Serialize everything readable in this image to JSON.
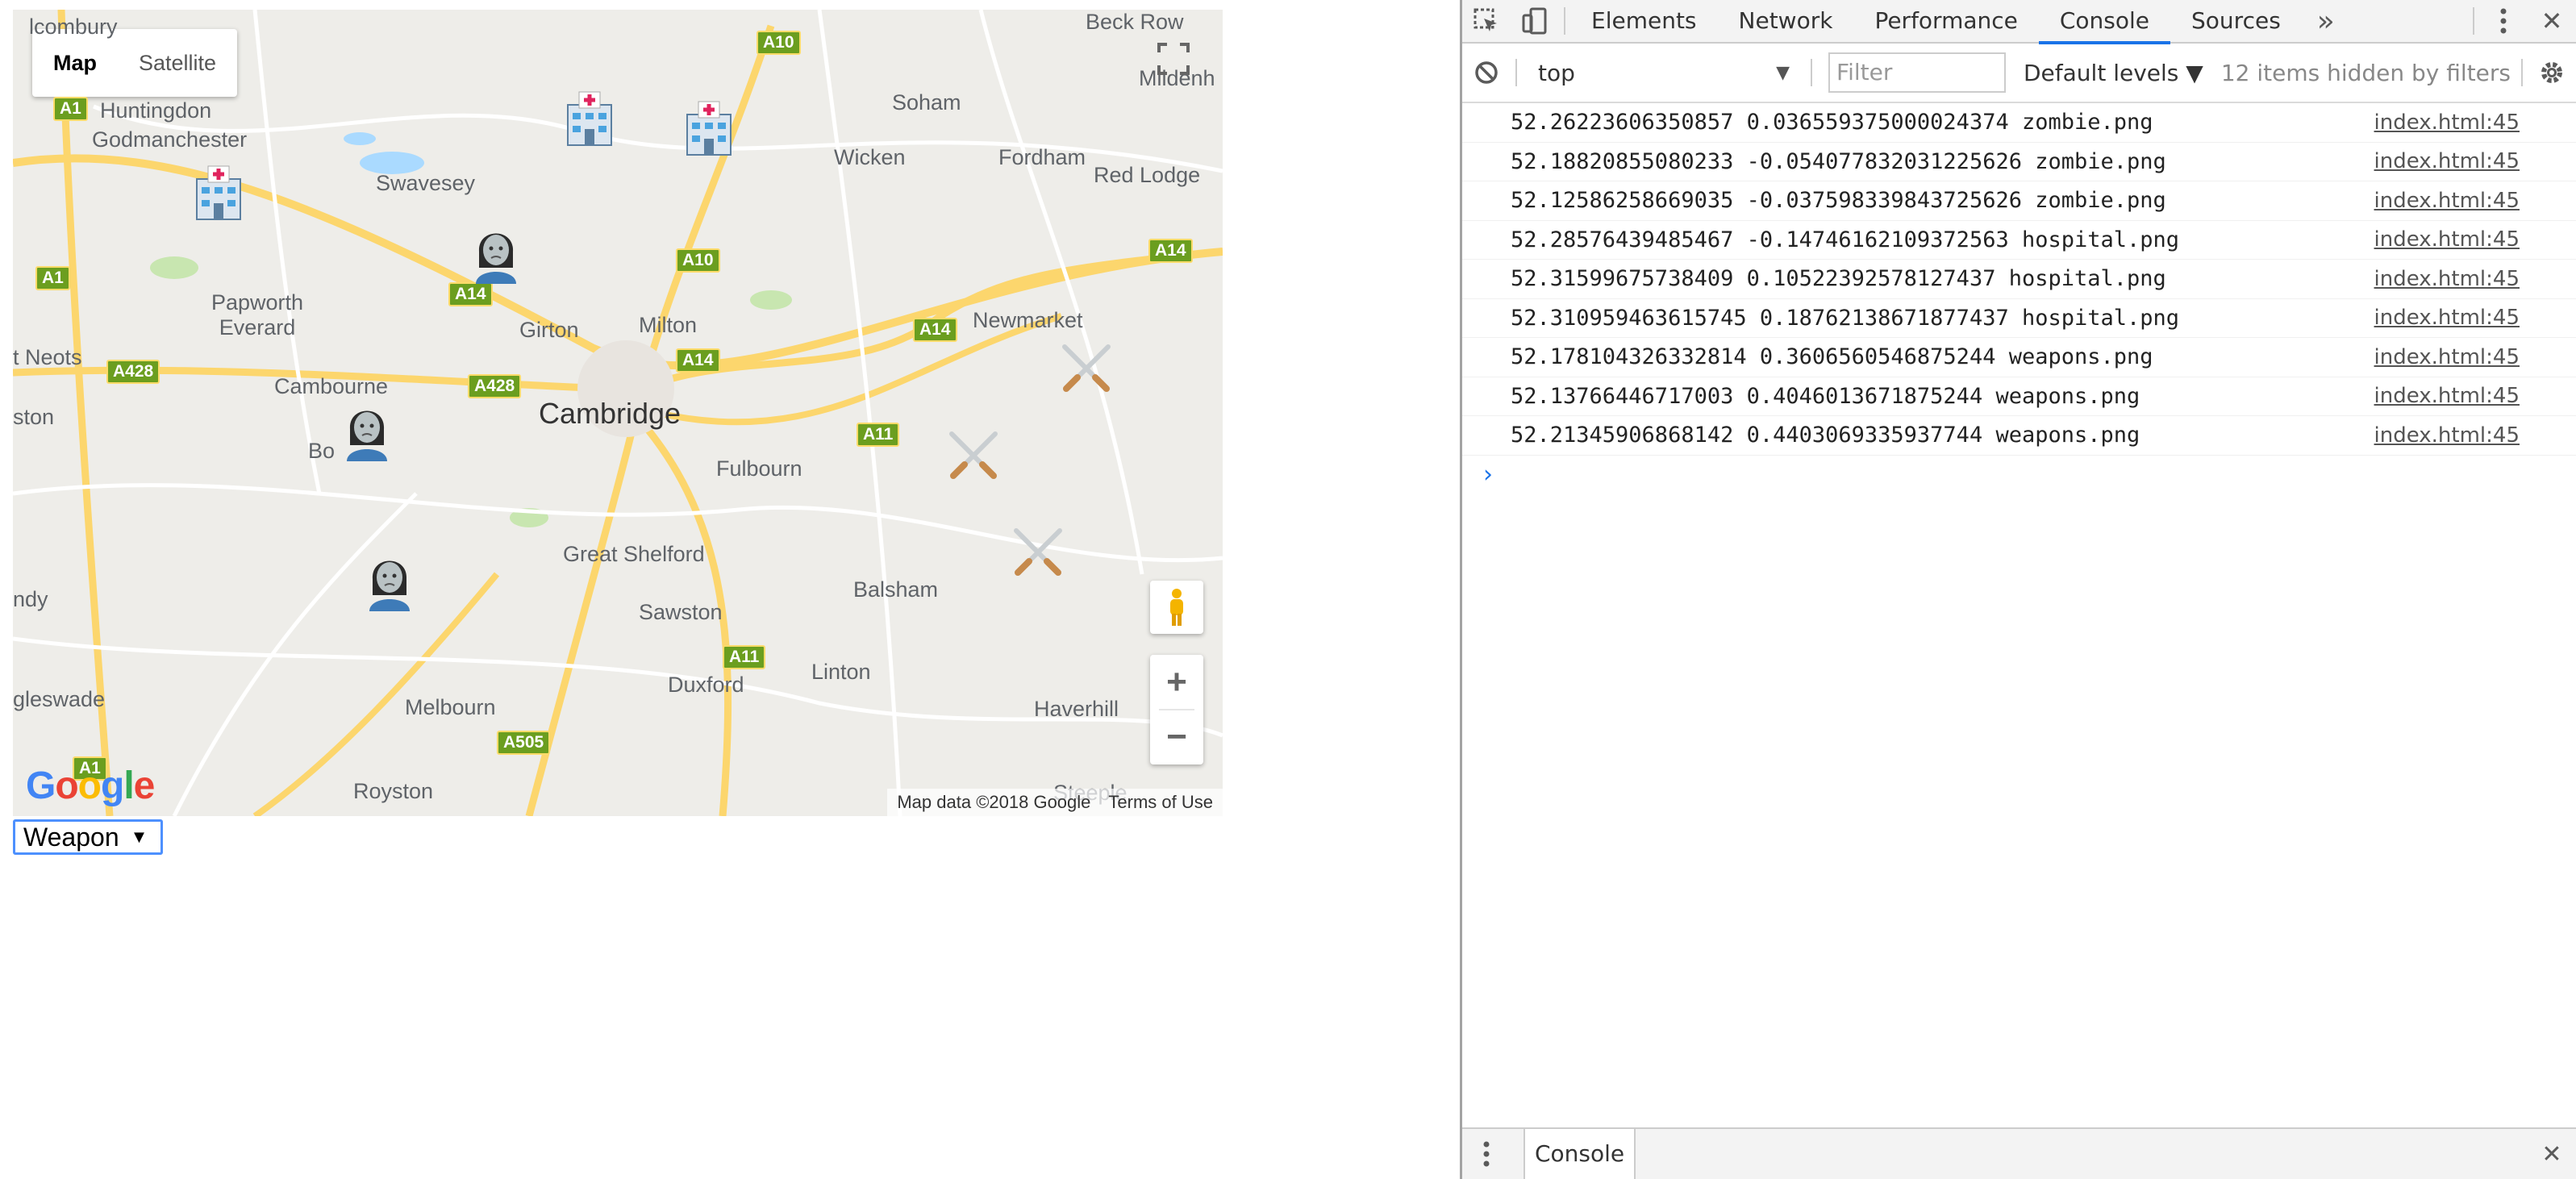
{
  "map": {
    "type_buttons": {
      "map": "Map",
      "satellite": "Satellite"
    },
    "places": {
      "huntingdon": "Huntingdon",
      "godmanchester": "Godmanchester",
      "swavesey": "Swavesey",
      "soham": "Soham",
      "wicken": "Wicken",
      "fordham": "Fordham",
      "red_lodge": "Red Lodge",
      "beck_row": "Beck Row",
      "mildenhall": "Mildenh",
      "papworth_everard": "Papworth\nEverard",
      "girton": "Girton",
      "milton": "Milton",
      "newmarket": "Newmarket",
      "st_neots": "t Neots",
      "cambourne": "Cambourne",
      "cambridge": "Cambridge",
      "fulbourn": "Fulbourn",
      "bourn": "Bo",
      "ston": "ston",
      "great_shelford": "Great Shelford",
      "balsham": "Balsham",
      "sawston": "Sawston",
      "linton": "Linton",
      "duxford": "Duxford",
      "melbourn": "Melbourn",
      "haverhill": "Haverhill",
      "biggleswade": "gleswade",
      "royston": "Royston",
      "sandy": "ndy",
      "icombury": "lcombury",
      "steeple": "Steeple"
    },
    "roads": {
      "a10_top": "A10",
      "a1_top": "A1",
      "a1_mid": "A1",
      "a14_left": "A14",
      "a10_mid": "A10",
      "a14_right": "A14",
      "a14_newmarket": "A14",
      "a428_left": "A428",
      "a428_right": "A428",
      "a14_center": "A14",
      "a11_mid": "A11",
      "a11_low": "A11",
      "a505": "A505",
      "a1_bottom": "A1"
    },
    "markers": [
      "hospital",
      "hospital",
      "hospital",
      "zombie",
      "zombie",
      "zombie",
      "weapons",
      "weapons",
      "weapons"
    ],
    "google": "Google",
    "attribution": "Map data ©2018 Google",
    "terms": "Terms of Use",
    "zoom_in": "+",
    "zoom_out": "−"
  },
  "select": {
    "value": "Weapon",
    "arrow": "▼"
  },
  "devtools": {
    "tabs": [
      "Elements",
      "Network",
      "Performance",
      "Console",
      "Sources"
    ],
    "active_tab": "Console",
    "more": "»",
    "context": "top",
    "context_arrow": "▼",
    "filter_placeholder": "Filter",
    "levels": "Default levels ▼",
    "hidden": "12 items hidden by filters",
    "logs": [
      {
        "text": "52.26223606350857 0.036559375000024374 zombie.png",
        "src": "index.html:45"
      },
      {
        "text": "52.18820855080233 -0.054077832031225626 zombie.png",
        "src": "index.html:45"
      },
      {
        "text": "52.12586258669035 -0.037598339843725626 zombie.png",
        "src": "index.html:45"
      },
      {
        "text": "52.28576439485467 -0.14746162109372563 hospital.png",
        "src": "index.html:45"
      },
      {
        "text": "52.31599675738409 0.10522392578127437 hospital.png",
        "src": "index.html:45"
      },
      {
        "text": "52.310959463615745 0.18762138671877437 hospital.png",
        "src": "index.html:45"
      },
      {
        "text": "52.178104326332814 0.3606560546875244 weapons.png",
        "src": "index.html:45"
      },
      {
        "text": "52.13766446717003 0.4046013671875244 weapons.png",
        "src": "index.html:45"
      },
      {
        "text": "52.21345906868142 0.4403069335937744 weapons.png",
        "src": "index.html:45"
      }
    ],
    "prompt": "›",
    "drawer_tab": "Console",
    "close": "✕"
  }
}
